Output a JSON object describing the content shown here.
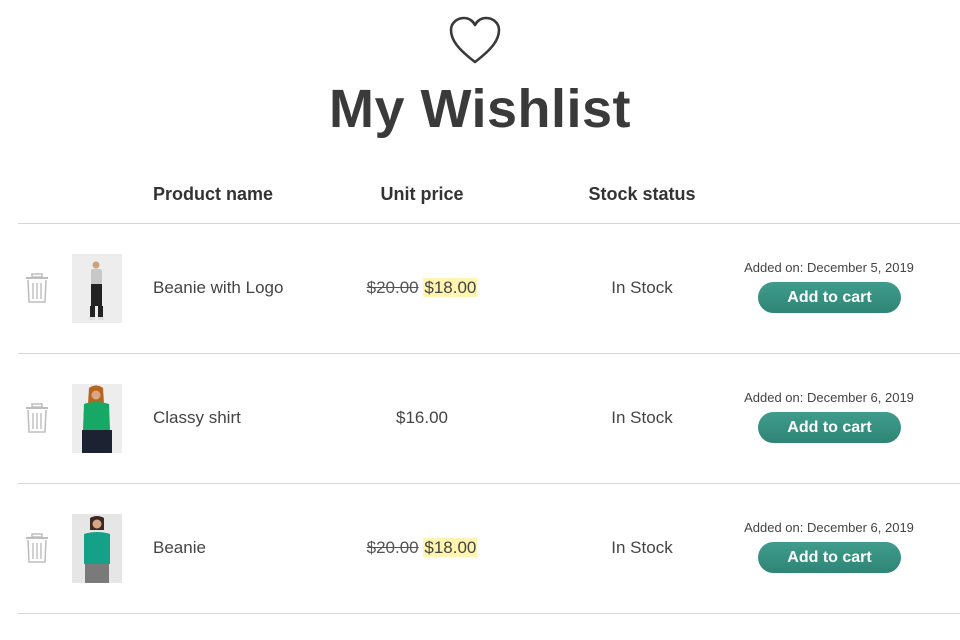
{
  "page": {
    "title": "My Wishlist"
  },
  "table": {
    "headers": {
      "product_name": "Product name",
      "unit_price": "Unit price",
      "stock_status": "Stock status"
    },
    "rows": [
      {
        "name": "Beanie with Logo",
        "old_price": "$20.00",
        "price": "$18.00",
        "stock": "In Stock",
        "added": "Added on: December 5, 2019",
        "button": "Add to cart"
      },
      {
        "name": "Classy shirt",
        "old_price": "",
        "price": "$16.00",
        "stock": "In Stock",
        "added": "Added on: December 6, 2019",
        "button": "Add to cart"
      },
      {
        "name": "Beanie",
        "old_price": "$20.00",
        "price": "$18.00",
        "stock": "In Stock",
        "added": "Added on: December 6, 2019",
        "button": "Add to cart"
      }
    ]
  },
  "colors": {
    "accent": "#3a9385",
    "sale_highlight": "#fff5b0",
    "text": "#3d3d3d"
  },
  "icons": {
    "header": "heart-icon",
    "remove": "trash-icon"
  }
}
